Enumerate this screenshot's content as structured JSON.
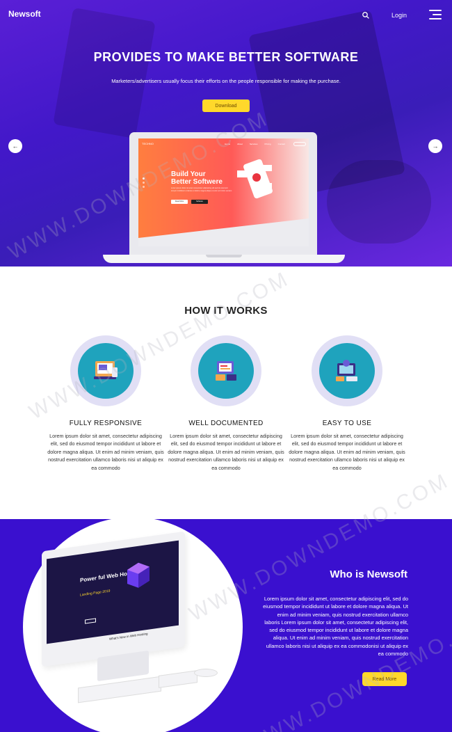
{
  "header": {
    "brand": "Newsoft",
    "login_label": "Login"
  },
  "hero": {
    "title": "PROVIDES TO MAKE BETTER SOFTWARE",
    "subtitle": "Marketers/advertisers usually focus their efforts on the people responsible for making the purchase.",
    "download_label": "Download",
    "mockup": {
      "logo": "TECHNO",
      "nav": [
        "Home",
        "About",
        "Services",
        "Pricing",
        "Contact"
      ],
      "heading_line1": "Build Your",
      "heading_line2": "Better Softwere",
      "text": "Lorem ipsum dolor sit amet consectetur adipisicing elit sed do eiusmod tempor incididunt ut labore et dolore magna aliqua ut enim ad minim veniam",
      "btn1": "Read More",
      "btn2": "Software"
    }
  },
  "how": {
    "title": "HOW IT WORKS",
    "features": [
      {
        "title": "FULLY RESPONSIVE",
        "text": "Lorem ipsum dolor sit amet, consectetur adipiscing elit, sed do eiusmod tempor incididunt ut labore et dolore magna aliqua. Ut enim ad minim veniam, quis nostrud exercitation ullamco laboris nisi ut aliquip ex ea commodo"
      },
      {
        "title": "WELL DOCUMENTED",
        "text": "Lorem ipsum dolor sit amet, consectetur adipiscing elit, sed do eiusmod tempor incididunt ut labore et dolore magna aliqua. Ut enim ad minim veniam, quis nostrud exercitation ullamco laboris nisi ut aliquip ex ea commodo"
      },
      {
        "title": "EASY TO USE",
        "text": "Lorem ipsum dolor sit amet, consectetur adipiscing elit, sed do eiusmod tempor incididunt ut labore et dolore magna aliqua. Ut enim ad minim veniam, quis nostrud exercitation ullamco laboris nisi ut aliquip ex ea commodo"
      }
    ]
  },
  "about": {
    "title": "Who is Newsoft",
    "text": "Lorem ipsum dolor sit amet, consectetur adipiscing elit, sed do eiusmod tempor incididunt ut labore et dolore magna aliqua. Ut enim ad minim veniam, quis nostrud exercitation ullamco laboris Lorem ipsum dolor sit amet, consectetur adipiscing elit, sed do eiusmod tempor incididunt ut labore et dolore magna aliqua. Ut enim ad minim veniam, quis nostrud exercitation ullamco laboris nisi ut aliquip ex ea commodonisi ut aliquip ex ea commodo",
    "readmore_label": "Read More",
    "mockup": {
      "heading": "Power ful Web Hosting",
      "sub": "Landing Page 2019",
      "caption": "What's New in Web Hosting"
    }
  },
  "watermark": "WWW.DOWNDEMO.COM",
  "colors": {
    "hero_gradient_start": "#5a1fd6",
    "about_bg": "#3a10cf",
    "accent_yellow": "#ffd82b",
    "feature_teal": "#1fa3bd",
    "feature_ring": "#e1dff5"
  }
}
